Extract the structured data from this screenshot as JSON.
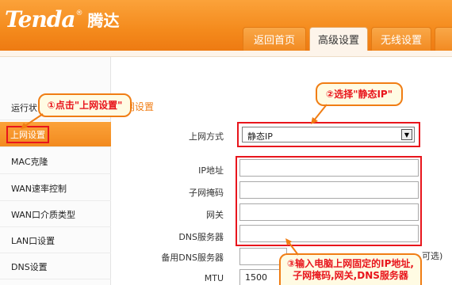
{
  "header": {
    "brand": "Tenda",
    "brand_reg": "®",
    "brand_cn": "腾达",
    "tabs": [
      "返回首页",
      "高级设置",
      "无线设置"
    ]
  },
  "sidebar": {
    "items": [
      {
        "label": "运行状"
      },
      {
        "label": "上网设置"
      },
      {
        "label": "MAC克隆"
      },
      {
        "label": "WAN速率控制"
      },
      {
        "label": "WAN口介质类型"
      },
      {
        "label": "LAN口设置"
      },
      {
        "label": "DNS设置"
      }
    ]
  },
  "main": {
    "section_title": "网设置",
    "fields": {
      "wan_type_label": "上网方式",
      "wan_type_value": "静态IP",
      "ip_label": "IP地址",
      "mask_label": "子网掩码",
      "gateway_label": "网关",
      "dns_label": "DNS服务器",
      "dns2_label": "备用DNS服务器",
      "dns2_suffix": "可选)",
      "mtu_label": "MTU",
      "mtu_value": "1500"
    }
  },
  "callouts": {
    "step1": "①点击\"上网设置\"",
    "step2": "②选择\"静态IP\"",
    "step3_line1": "③输入电脑上网固定的IP地址,",
    "step3_line2": "子网掩码,网关,DNS服务器"
  },
  "colors": {
    "accent": "#f28a1e",
    "highlight": "#e8151c",
    "callout_border": "#f07d14"
  }
}
